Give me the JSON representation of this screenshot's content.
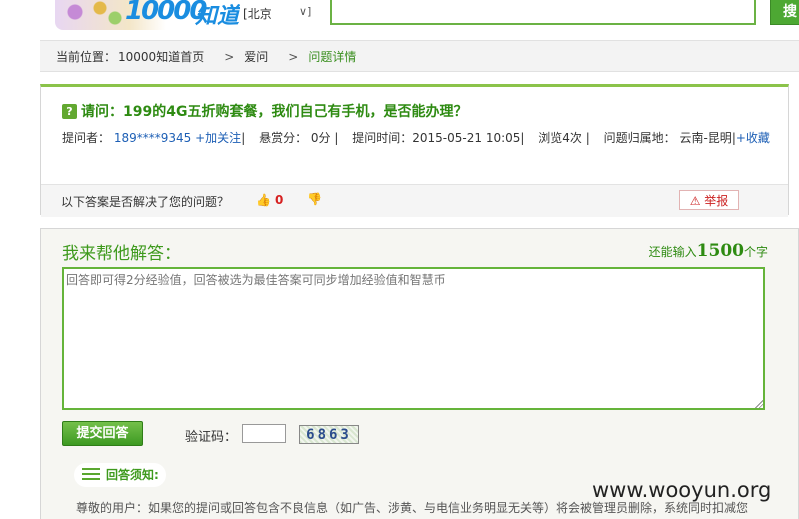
{
  "header": {
    "logo_num": "10000",
    "logo_text": "知道",
    "city": "北京",
    "search_button": "搜"
  },
  "breadcrumb": {
    "prefix": "当前位置：",
    "items": [
      "10000知道首页",
      "爱问",
      "问题详情"
    ],
    "sep": ">"
  },
  "question": {
    "title": "请问：199的4G五折购套餐，我们自己有手机，是否能办理？",
    "asker_label": "提问者：",
    "asker": "189****9345",
    "follow": "+加关注",
    "reward_label": "悬赏分：",
    "reward": "0分",
    "time_label": "提问时间：",
    "time": "2015-05-21 10:05",
    "views": "浏览4次",
    "region_label": "问题归属地：",
    "region": "云南-昆明",
    "favorite": "+收藏",
    "resolved_prompt": "以下答案是否解决了您的问题？",
    "up_count": "0",
    "report": "举报"
  },
  "answer": {
    "heading": "我来帮他解答：",
    "remain_prefix": "还能输入",
    "remain_count": "1500",
    "remain_suffix": "个字",
    "placeholder": "回答即可得2分经验值，回答被选为最佳答案可同步增加经验值和智慧币",
    "submit": "提交回答",
    "captcha_label": "验证码：",
    "captcha": "6863",
    "notice_title": "回答须知:",
    "notice_text": "尊敬的用户：如果您的提问或回答包含不良信息（如广告、涉黄、与电信业务明显无关等）将会被管理员删除，系统同时扣减您"
  },
  "watermark": "www.wooyun.org"
}
